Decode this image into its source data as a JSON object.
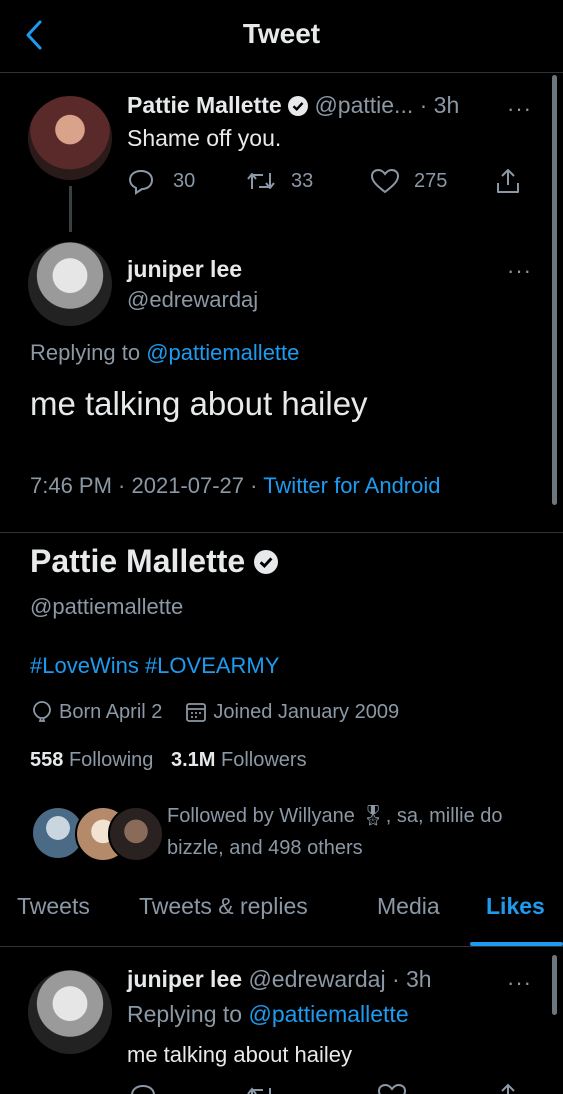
{
  "header": {
    "title": "Tweet"
  },
  "parent_tweet": {
    "name": "Pattie Mallette",
    "handle_time": "@pattie... · 3h",
    "text": "Shame off you.",
    "replies": "30",
    "retweets": "33",
    "likes": "275"
  },
  "main_tweet": {
    "name": "juniper lee",
    "handle": "@edrewardaj",
    "replying_prefix": "Replying to",
    "replying_to": "@pattiemallette",
    "text": "me talking about hailey",
    "timestamp": "7:46 PM · 2021-07-27 ·",
    "source": "Twitter for Android"
  },
  "profile": {
    "name": "Pattie Mallette",
    "handle": "@pattiemallette",
    "bio": "#LoveWins #LOVEARMY",
    "born": "Born April 2",
    "joined": "Joined January 2009",
    "following_count": "558",
    "following_label": "Following",
    "followers_count": "3.1M",
    "followers_label": "Followers",
    "followed_by_line1": "Followed by Willyane 🎖, sa, millie do",
    "followed_by_line2": "bizzle, and 498 others"
  },
  "tabs": [
    {
      "label": "Tweets"
    },
    {
      "label": "Tweets & replies"
    },
    {
      "label": "Media"
    },
    {
      "label": "Likes",
      "active": true
    }
  ],
  "liked_tweet": {
    "name": "juniper lee",
    "handle_time": "@edrewardaj · 3h",
    "replying_prefix": "Replying to",
    "replying_to": "@pattiemallette",
    "text": "me talking about hailey"
  },
  "colors": {
    "accent": "#1d9bf0",
    "background": "#000000",
    "text": "#e7e9ea",
    "secondary": "#8b98a5"
  }
}
